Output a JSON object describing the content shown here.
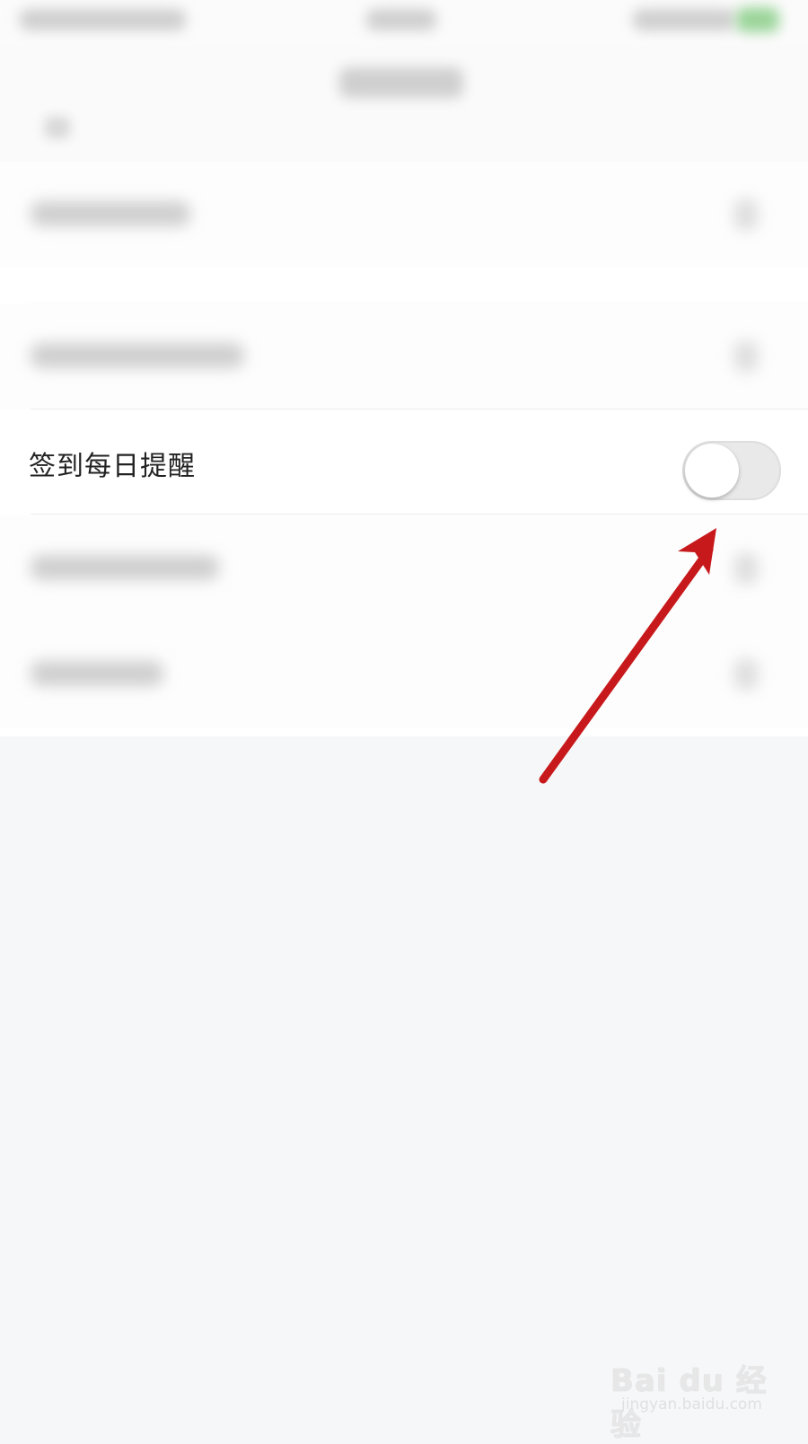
{
  "settings": {
    "reminder_row": {
      "label": "签到每日提醒",
      "toggle_on": false
    }
  },
  "colors": {
    "toggle_track_off": "#e9e9ea",
    "annotation_arrow": "#c7191c",
    "page_background": "#f6f7f9"
  },
  "watermark": {
    "brand": "Bai du 经验",
    "url": "jingyan.baidu.com"
  }
}
